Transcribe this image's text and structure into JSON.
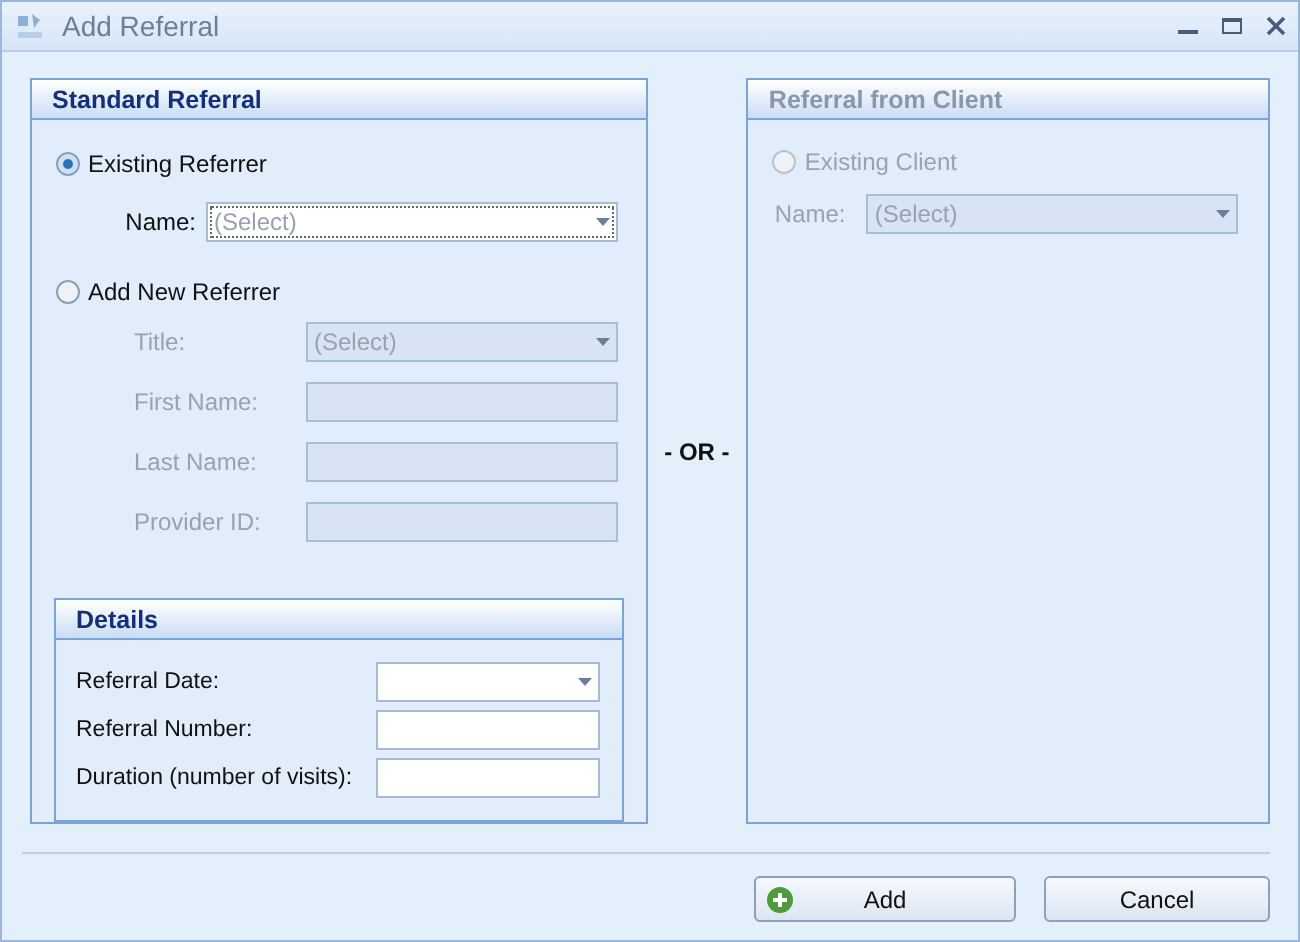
{
  "window": {
    "title": "Add Referral"
  },
  "standard_referral": {
    "title": "Standard Referral",
    "existing_referrer": {
      "label": "Existing Referrer",
      "selected": true,
      "name_label": "Name:",
      "name_placeholder": "(Select)"
    },
    "add_new_referrer": {
      "label": "Add New Referrer",
      "selected": false,
      "disabled": true,
      "fields": [
        {
          "label": "Title:",
          "kind": "select",
          "placeholder": "(Select)"
        },
        {
          "label": "First Name:",
          "kind": "text"
        },
        {
          "label": "Last Name:",
          "kind": "text"
        },
        {
          "label": "Provider ID:",
          "kind": "text"
        }
      ]
    },
    "details": {
      "title": "Details",
      "fields": [
        {
          "label": "Referral Date:",
          "kind": "select"
        },
        {
          "label": "Referral Number:",
          "kind": "text"
        },
        {
          "label": "Duration (number of visits):",
          "kind": "text"
        }
      ]
    }
  },
  "separator": "- OR -",
  "referral_from_client": {
    "title": "Referral from Client",
    "disabled": true,
    "existing_client": {
      "label": "Existing Client",
      "selected": false
    },
    "name_label": "Name:",
    "name_placeholder": "(Select)"
  },
  "buttons": [
    {
      "label": "Add",
      "kind": "add"
    },
    {
      "label": "Cancel",
      "kind": "plain"
    }
  ]
}
